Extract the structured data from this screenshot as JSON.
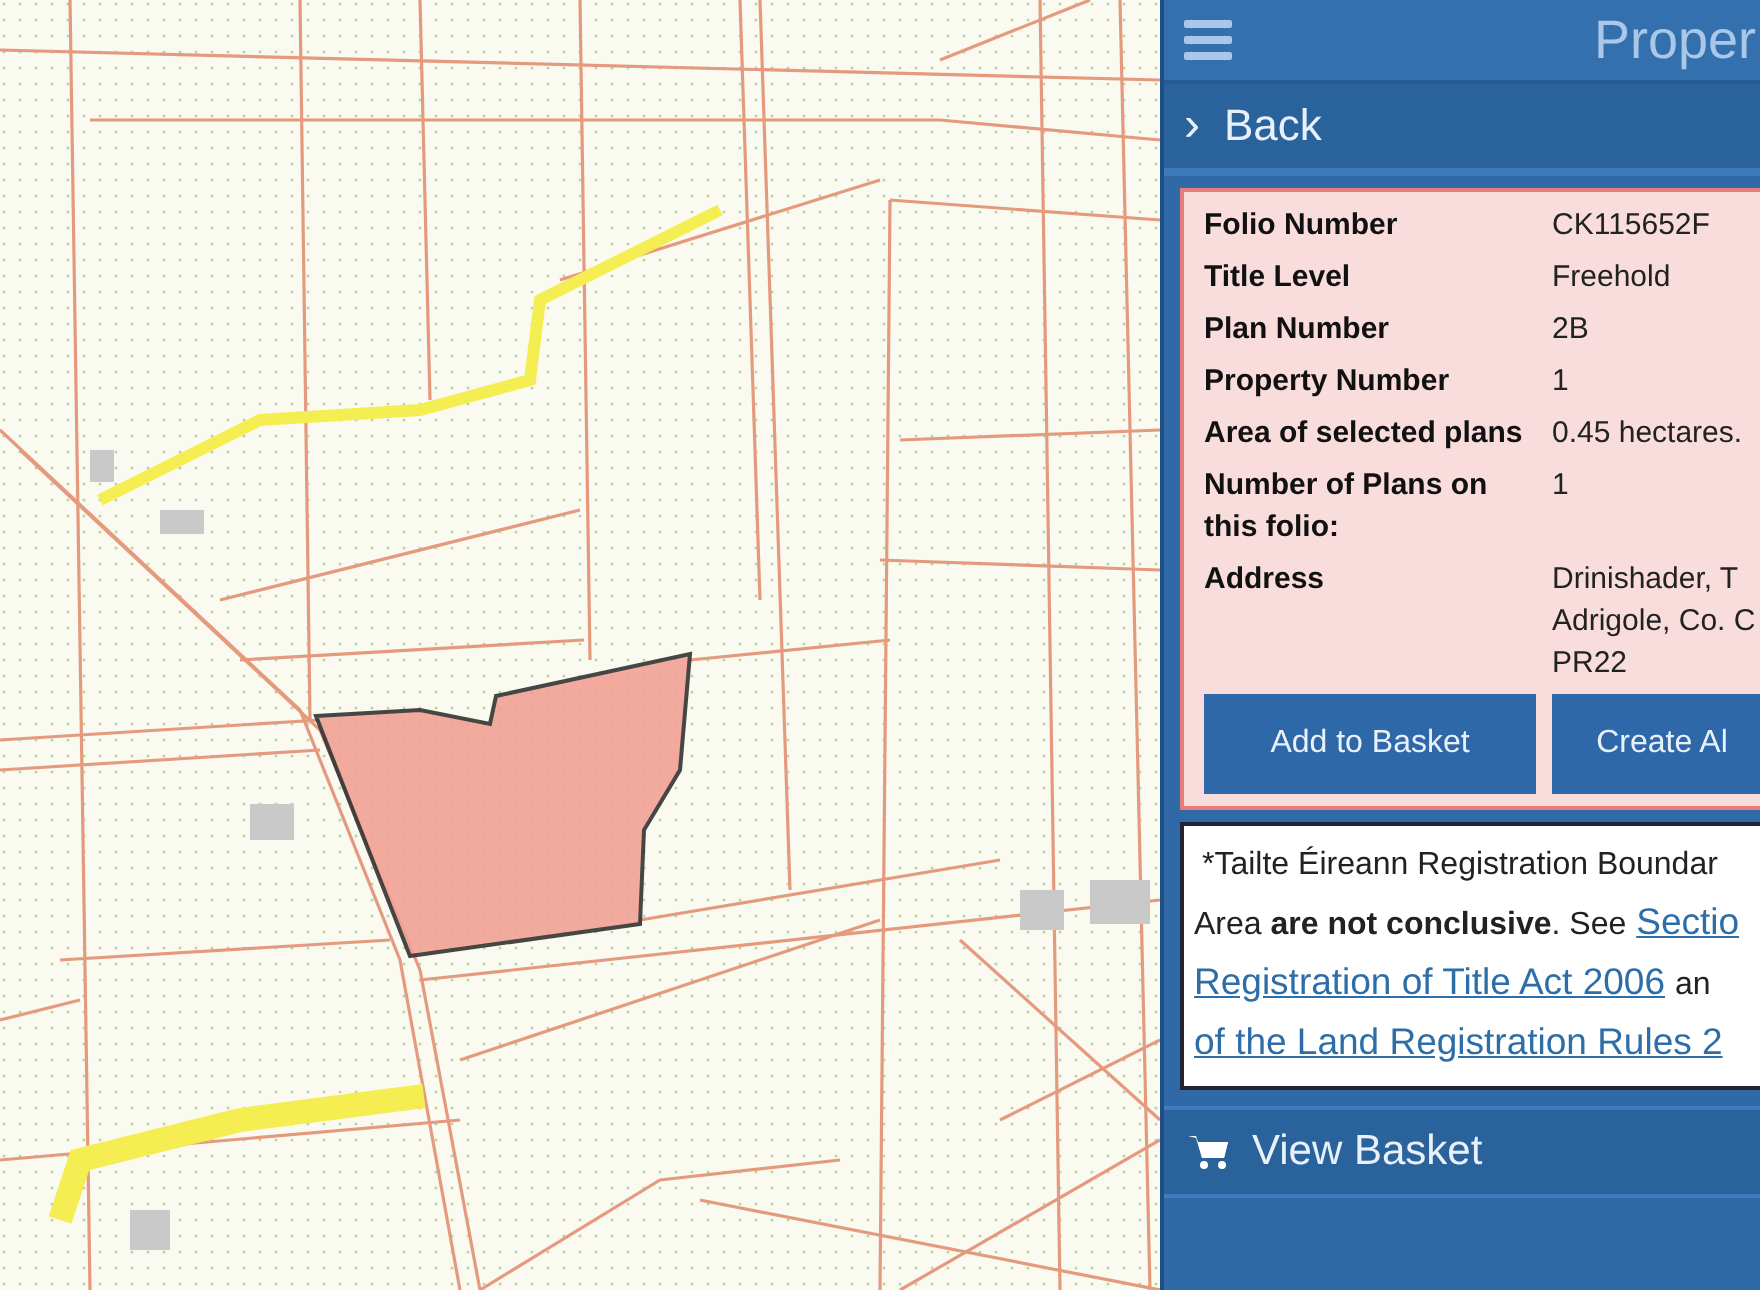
{
  "header": {
    "title": "Proper"
  },
  "back": {
    "label": "Back",
    "icon": "›"
  },
  "details": [
    {
      "label": "Folio Number",
      "value": [
        "CK115652F"
      ]
    },
    {
      "label": "Title Level",
      "value": [
        "Freehold"
      ]
    },
    {
      "label": "Plan Number",
      "value": [
        "2B"
      ]
    },
    {
      "label": "Property Number",
      "value": [
        "1"
      ]
    },
    {
      "label": "Area of selected plans",
      "value": [
        "0.45 hectares."
      ]
    },
    {
      "label": "Number of Plans on this folio:",
      "value": [
        "1"
      ]
    },
    {
      "label": "Address",
      "value": [
        "Drinishader, T",
        "Adrigole, Co. C",
        "PR22"
      ]
    }
  ],
  "buttons": [
    "Add to Basket",
    "Create Al"
  ],
  "disclaimer": [
    [
      {
        "kind": "text",
        "text": "*Tailte Éireann Registration Boundar"
      }
    ],
    [
      {
        "kind": "text",
        "text": "Area **are not conclusive**. See"
      },
      {
        "kind": "link",
        "text": "Sectio"
      }
    ],
    [
      {
        "kind": "link",
        "text": "Registration of Title Act 2006"
      },
      {
        "kind": "text",
        "text": "an"
      }
    ],
    [
      {
        "kind": "link",
        "text": "of the Land Registration Rules 2"
      }
    ]
  ],
  "basket": {
    "label": "View Basket"
  }
}
